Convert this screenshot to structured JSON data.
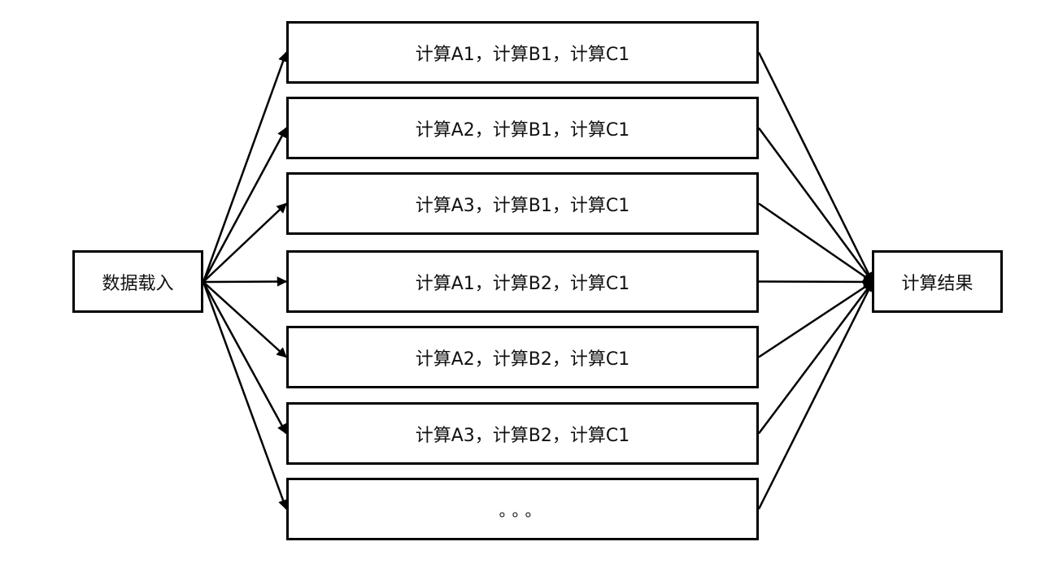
{
  "input": {
    "label": "数据载入"
  },
  "output": {
    "label": "计算结果"
  },
  "combinations": [
    {
      "label": "计算A1，计算B1，计算C1"
    },
    {
      "label": "计算A2，计算B1，计算C1"
    },
    {
      "label": "计算A3，计算B1，计算C1"
    },
    {
      "label": "计算A1，计算B2，计算C1"
    },
    {
      "label": "计算A2，计算B2，计算C1"
    },
    {
      "label": "计算A3，计算B2，计算C1"
    },
    {
      "label": "。。。"
    }
  ],
  "colors": {
    "stroke": "#000000",
    "text": "#111111",
    "background": "#ffffff"
  }
}
